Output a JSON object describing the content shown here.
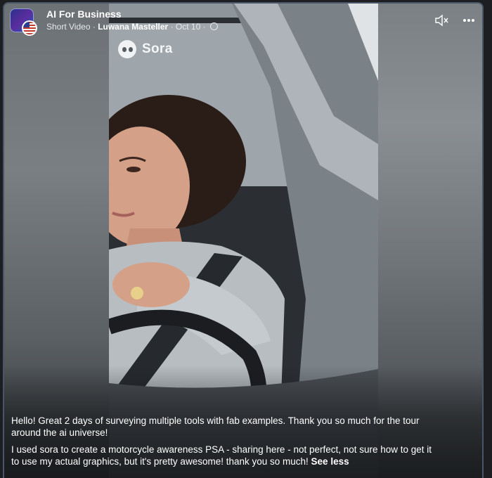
{
  "post": {
    "group_name": "AI For Business",
    "type_label": "Short Video",
    "separator": "·",
    "author": "Luwana Masteller",
    "date": "Oct 10",
    "privacy_icon": "globe-icon",
    "watermark": "Sora",
    "caption_1": "Hello! Great 2 days of surveying multiple tools with fab examples. Thank you so much for the tour around the ai universe!",
    "caption_2": "I used sora to create a motorcycle awareness PSA - sharing here - not perfect, not sure how to get it to use my actual graphics, but it's pretty awesome! thank you so much!",
    "see_less": "See less"
  },
  "controls": {
    "mute_icon": "speaker-muted-icon",
    "more_icon": "more-options-icon"
  }
}
